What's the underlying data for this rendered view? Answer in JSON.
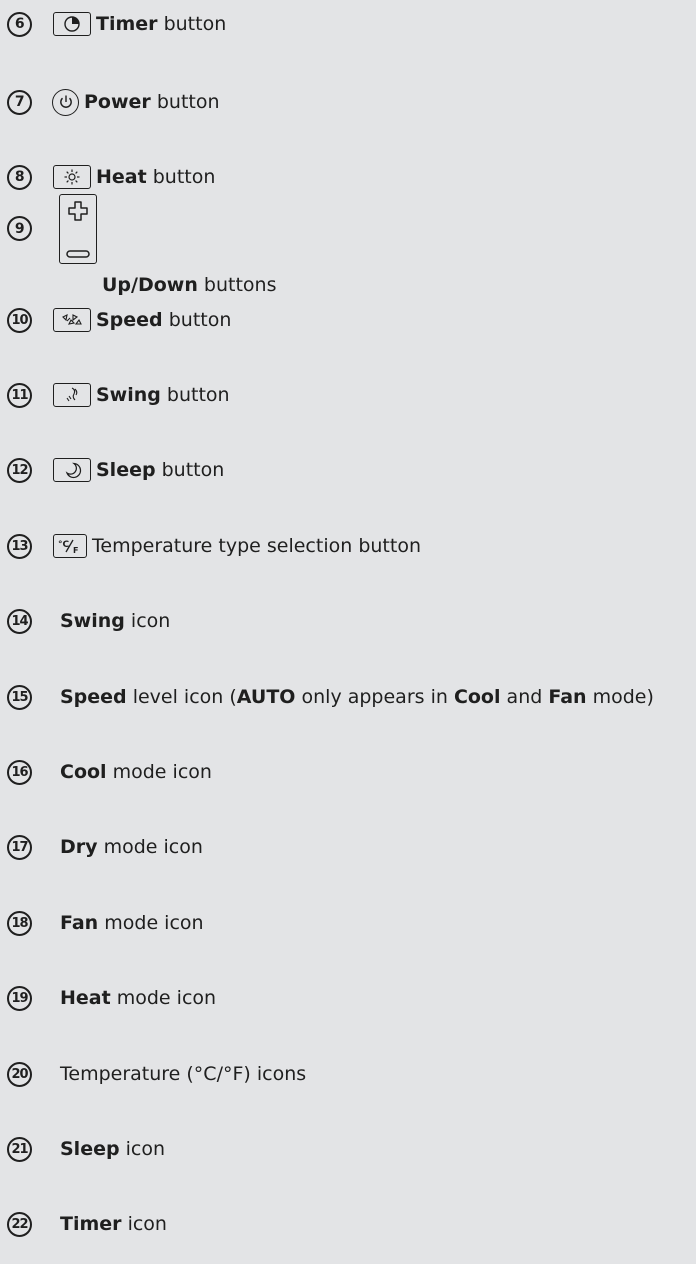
{
  "items": [
    {
      "number": "6",
      "bold": "Timer",
      "rest": " button",
      "icon": "timer-icon"
    },
    {
      "number": "7",
      "bold": "Power",
      "rest": " button",
      "icon": "power-icon"
    },
    {
      "number": "8",
      "bold": "Heat",
      "rest": " button",
      "icon": "heat-icon"
    },
    {
      "number": "9",
      "bold": "Up/Down",
      "rest": " buttons",
      "icon": "plus-minus-icon"
    },
    {
      "number": "10",
      "bold": "Speed",
      "rest": " button",
      "icon": "fan-speed-icon"
    },
    {
      "number": "11",
      "bold": "Swing",
      "rest": " button",
      "icon": "swing-icon"
    },
    {
      "number": "12",
      "bold": "Sleep",
      "rest": " button",
      "icon": "moon-icon"
    },
    {
      "number": "13",
      "bold": "",
      "rest": "Temperature type selection button",
      "icon": "celsius-fahrenheit-icon"
    },
    {
      "number": "14",
      "bold": "Swing",
      "rest": " icon"
    },
    {
      "number": "15",
      "bold": "Speed",
      "rest": " level icon (",
      "bold2": "AUTO",
      "rest2": " only appears in ",
      "bold3": "Cool",
      "rest3": " and ",
      "bold4": "Fan",
      "rest4": " mode)"
    },
    {
      "number": "16",
      "bold": "Cool",
      "rest": " mode icon"
    },
    {
      "number": "17",
      "bold": "Dry",
      "rest": " mode icon"
    },
    {
      "number": "18",
      "bold": "Fan",
      "rest": " mode icon"
    },
    {
      "number": "19",
      "bold": "Heat",
      "rest": " mode icon"
    },
    {
      "number": "20",
      "bold": "",
      "rest": "Temperature (°C/°F) icons"
    },
    {
      "number": "21",
      "bold": "Sleep",
      "rest": " icon"
    },
    {
      "number": "22",
      "bold": "Timer",
      "rest": " icon"
    }
  ],
  "colors": {
    "background": "#e3e4e6",
    "ink": "#1f1f1f"
  }
}
